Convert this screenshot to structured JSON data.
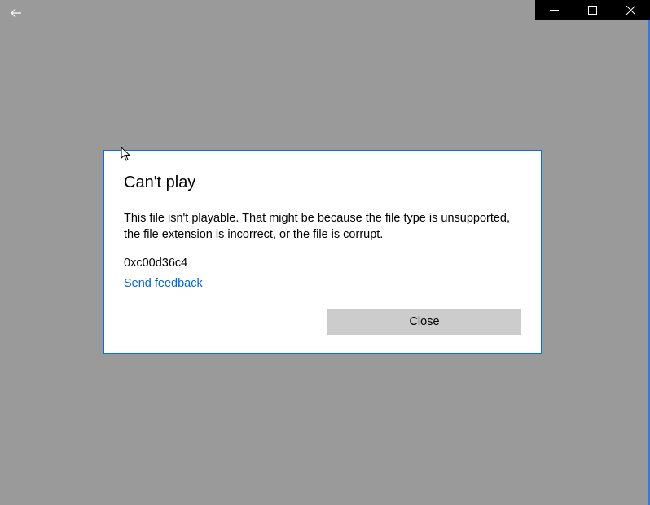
{
  "dialog": {
    "title": "Can't play",
    "message": "This file isn't playable. That might be because the file type is unsupported, the file extension is incorrect, or the file is corrupt.",
    "error_code": "0xc00d36c4",
    "feedback_link": "Send feedback",
    "close_label": "Close"
  }
}
